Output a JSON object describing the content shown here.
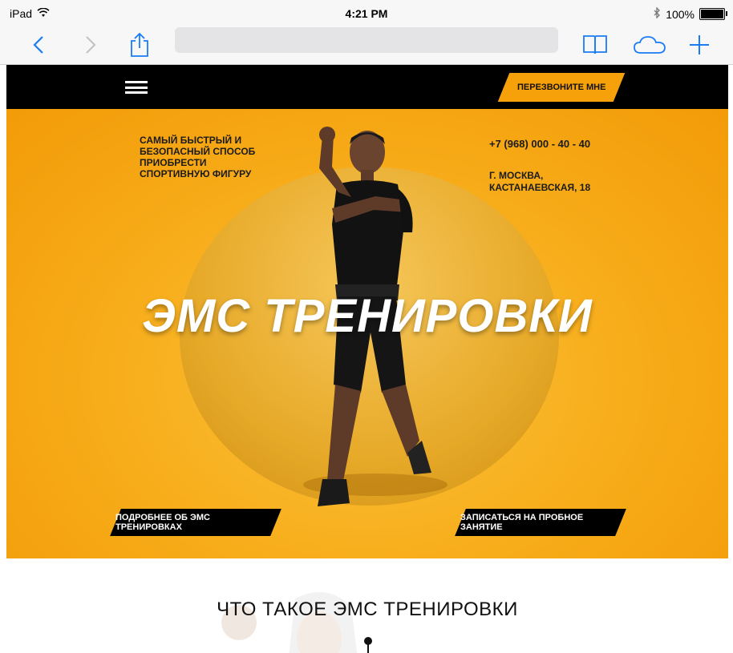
{
  "status_bar": {
    "device": "iPad",
    "time": "4:21 PM",
    "battery": "100%"
  },
  "browser": {
    "url": ""
  },
  "header": {
    "callback_label": "ПЕРЕЗВОНИТЕ МНЕ"
  },
  "hero": {
    "tagline": "САМЫЙ БЫСТРЫЙ И БЕЗОПАСНЫЙ СПОСОБ ПРИОБРЕСТИ СПОРТИВНУЮ ФИГУРУ",
    "phone": "+7 (968) 000 - 40 - 40",
    "address_line1": "Г. МОСКВА,",
    "address_line2": "КАСТАНАЕВСКАЯ, 18",
    "title": "ЭМС ТРЕНИРОВКИ",
    "cta_more": "ПОДРОБНЕЕ ОБ ЭМС ТРЕНИРОВКАХ",
    "cta_signup": "ЗАПИСАТЬСЯ НА ПРОБНОЕ ЗАНЯТИЕ"
  },
  "section": {
    "title": "ЧТО ТАКОЕ ЭМС ТРЕНИРОВКИ"
  },
  "colors": {
    "accent": "#f7a10a",
    "topbar": "#000000",
    "hero_bg": "#f7ab18"
  },
  "icons": [
    "wifi-icon",
    "bluetooth-icon",
    "battery-icon",
    "back-icon",
    "forward-icon",
    "share-icon",
    "bookmarks-icon",
    "cloud-icon",
    "new-tab-icon",
    "menu-icon"
  ]
}
